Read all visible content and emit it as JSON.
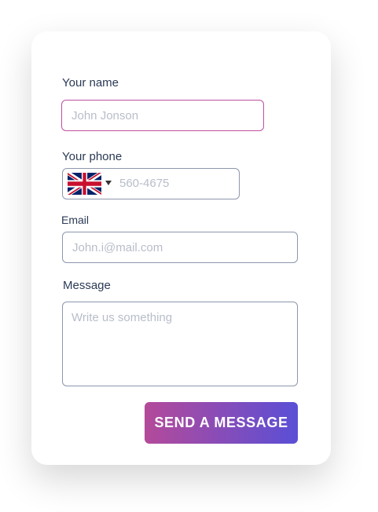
{
  "form": {
    "name": {
      "label": "Your name",
      "placeholder": "John Jonson"
    },
    "phone": {
      "label": "Your phone",
      "placeholder": "560-4675",
      "country_flag_icon": "uk-flag-icon",
      "dropdown_icon": "caret-down-icon"
    },
    "email": {
      "label": "Email",
      "placeholder": "John.i@mail.com"
    },
    "message": {
      "label": "Message",
      "placeholder": "Write us something"
    },
    "submit": {
      "label": "SEND A MESSAGE"
    }
  },
  "colors": {
    "card_bg": "#ffffff",
    "label": "#2b3a55",
    "input_border": "#8d96ad",
    "active_border": "#c04f9e",
    "placeholder": "#b8bdc9",
    "button_gradient_start": "#b44a9a",
    "button_gradient_end": "#5a4fd6"
  }
}
